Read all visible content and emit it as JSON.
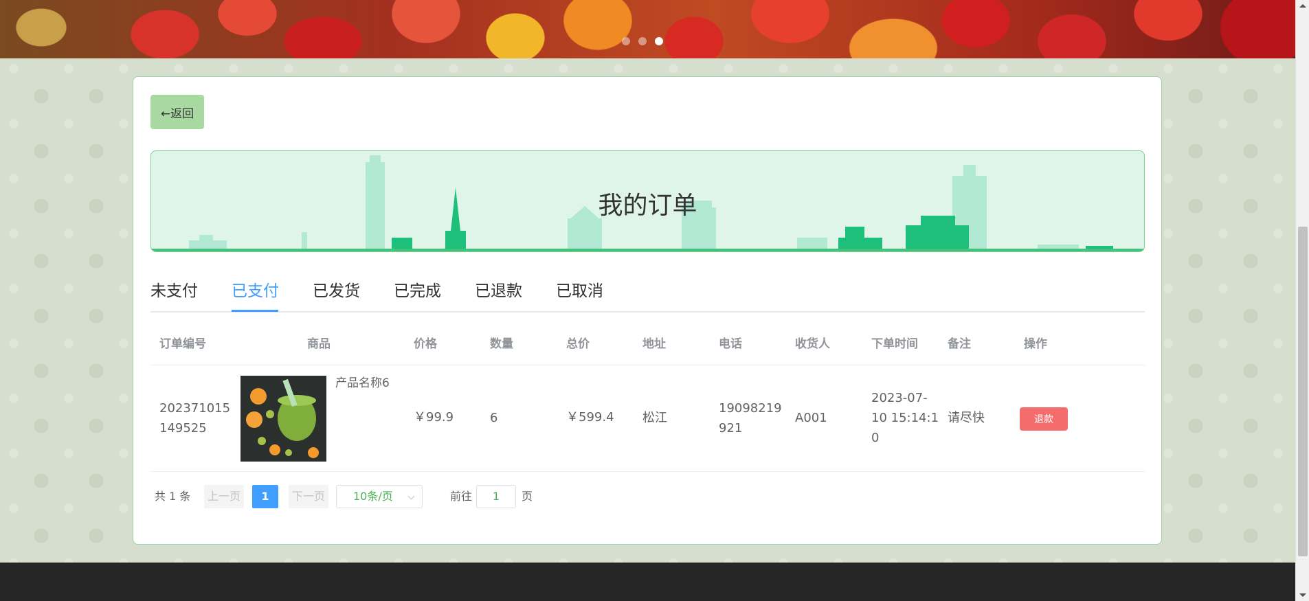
{
  "banner": {
    "slides_total": 3,
    "active_slide": 3
  },
  "back_button": {
    "label": "←返回"
  },
  "hero": {
    "title": "我的订单"
  },
  "tabs": [
    {
      "label": "未支付"
    },
    {
      "label": "已支付"
    },
    {
      "label": "已发货"
    },
    {
      "label": "已完成"
    },
    {
      "label": "已退款"
    },
    {
      "label": "已取消"
    }
  ],
  "active_tab": "已支付",
  "table": {
    "headers": [
      "订单编号",
      "商品",
      "价格",
      "数量",
      "总价",
      "地址",
      "电话",
      "收货人",
      "下单时间",
      "备注",
      "操作"
    ],
    "rows": [
      {
        "order_no_line1": "202371015",
        "order_no_line2": "149525",
        "product_name": "产品名称6",
        "price": "￥99.9",
        "quantity": "6",
        "total": "￥599.4",
        "address": "松江",
        "phone_line1": "19098219",
        "phone_line2": "921",
        "receiver": "A001",
        "time_line1": "2023-07-",
        "time_line2": "10 15:14:1",
        "time_line3": "0",
        "note": "请尽快",
        "action": "退款"
      }
    ]
  },
  "pagination": {
    "total": "共 1 条",
    "prev": "上一页",
    "current": "1",
    "next": "下一页",
    "page_size": "10条/页",
    "goto": "前往",
    "goto_value": "1",
    "page_unit": "页"
  },
  "colors": {
    "accent": "#409eff",
    "back_button": "#a8d9a0",
    "danger": "#f56c6c",
    "hero_bg": "#e0f5ea"
  }
}
